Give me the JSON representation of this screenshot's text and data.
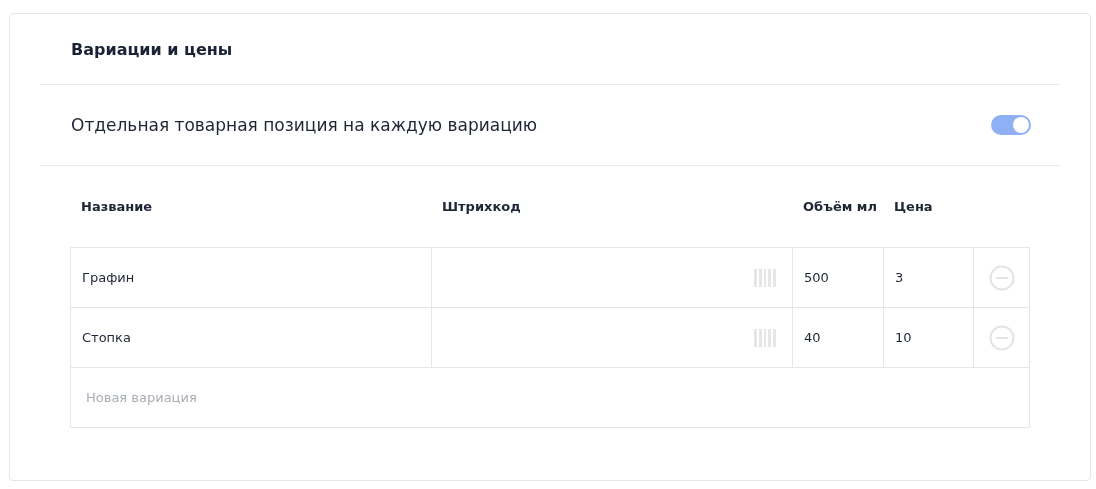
{
  "title": "Вариации и цены",
  "separate_item": {
    "label": "Отдельная товарная позиция на каждую вариацию",
    "on": true
  },
  "table": {
    "columns": [
      "Название",
      "Штрихкод",
      "Объём мл",
      "Цена"
    ],
    "rows": [
      {
        "name": "Графин",
        "volume": "500",
        "price": "3"
      },
      {
        "name": "Стопка",
        "volume": "40",
        "price": "10"
      }
    ],
    "new_row": {
      "placeholder": "Новая вариация"
    }
  }
}
